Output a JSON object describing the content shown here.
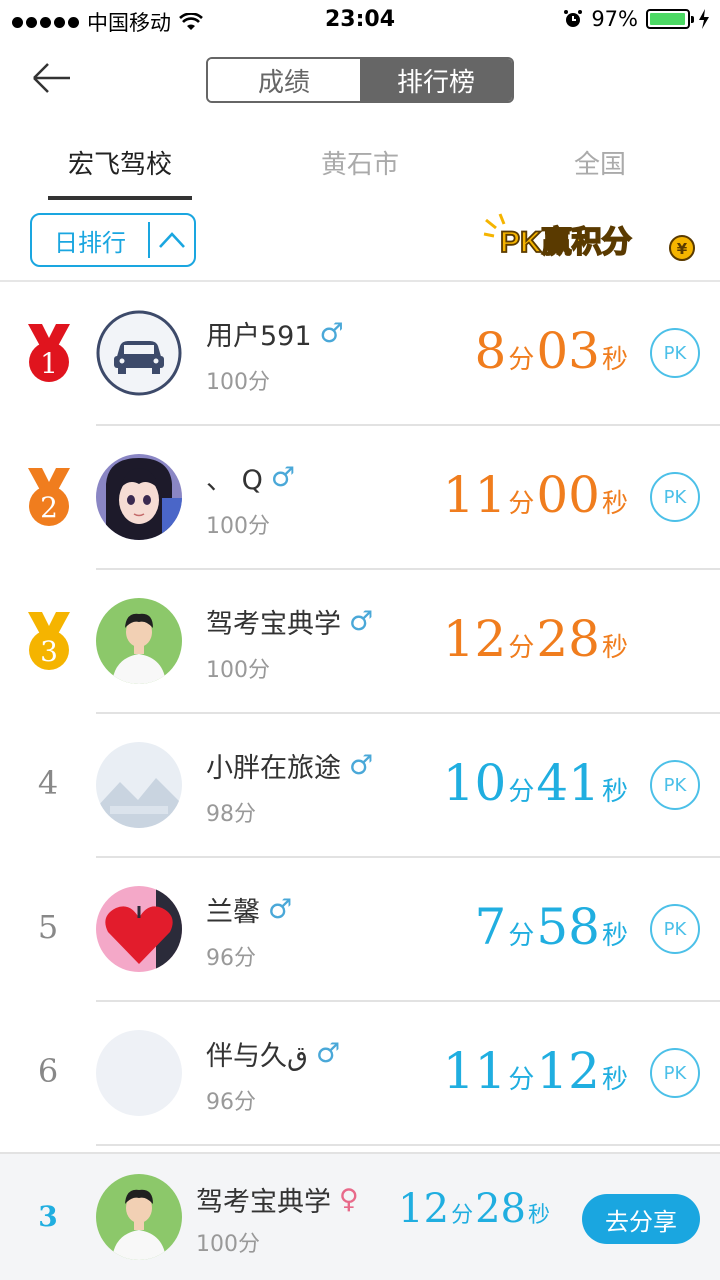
{
  "status_bar": {
    "carrier": "中国移动",
    "time": "23:04",
    "battery": "97%",
    "battery_level": 0.97
  },
  "nav": {
    "segments": [
      "成绩",
      "排行榜"
    ],
    "active_segment": "排行榜"
  },
  "tabs": [
    {
      "label": "宏飞驾校",
      "active": true
    },
    {
      "label": "黄石市",
      "active": false
    },
    {
      "label": "全国",
      "active": false
    }
  ],
  "filter": {
    "label": "日排行"
  },
  "pk_banner": {
    "text": "PK赢积分"
  },
  "colors": {
    "accent": "#1aa6e0",
    "top_time": "#f07d1e",
    "normal_time": "#20aee0",
    "male": "#4aa8d8",
    "female": "#e86a8a"
  },
  "rows": [
    {
      "rank": "1",
      "medal": "red",
      "name": "用户591",
      "gender": "♂",
      "score": "100分",
      "min": "8",
      "min_unit": "分",
      "sec": "03",
      "sec_unit": "秒",
      "pk": "PK",
      "avatar": "car-avatar"
    },
    {
      "rank": "2",
      "medal": "orange",
      "name": "、 Q",
      "gender": "♂",
      "score": "100分",
      "min": "11",
      "min_unit": "分",
      "sec": "00",
      "sec_unit": "秒",
      "pk": "PK",
      "avatar": "anime-avatar"
    },
    {
      "rank": "3",
      "medal": "gold",
      "name": "驾考宝典学",
      "gender": "♂",
      "score": "100分",
      "min": "12",
      "min_unit": "分",
      "sec": "28",
      "sec_unit": "秒",
      "pk": "",
      "avatar": "person-avatar"
    },
    {
      "rank": "4",
      "medal": "",
      "name": "小胖在旅途",
      "gender": "♂",
      "score": "98分",
      "min": "10",
      "min_unit": "分",
      "sec": "41",
      "sec_unit": "秒",
      "pk": "PK",
      "avatar": "placeholder-avatar"
    },
    {
      "rank": "5",
      "medal": "",
      "name": "兰馨",
      "gender": "♂",
      "score": "96分",
      "min": "7",
      "min_unit": "分",
      "sec": "58",
      "sec_unit": "秒",
      "pk": "PK",
      "avatar": "love-avatar"
    },
    {
      "rank": "6",
      "medal": "",
      "name": "伴与久ق",
      "gender": "♂",
      "score": "96分",
      "min": "11",
      "min_unit": "分",
      "sec": "12",
      "sec_unit": "秒",
      "pk": "PK",
      "avatar": "blank-avatar"
    }
  ],
  "me": {
    "rank": "3",
    "name": "驾考宝典学",
    "gender": "♀",
    "score": "100分",
    "min": "12",
    "min_unit": "分",
    "sec": "28",
    "sec_unit": "秒",
    "share": "去分享"
  }
}
